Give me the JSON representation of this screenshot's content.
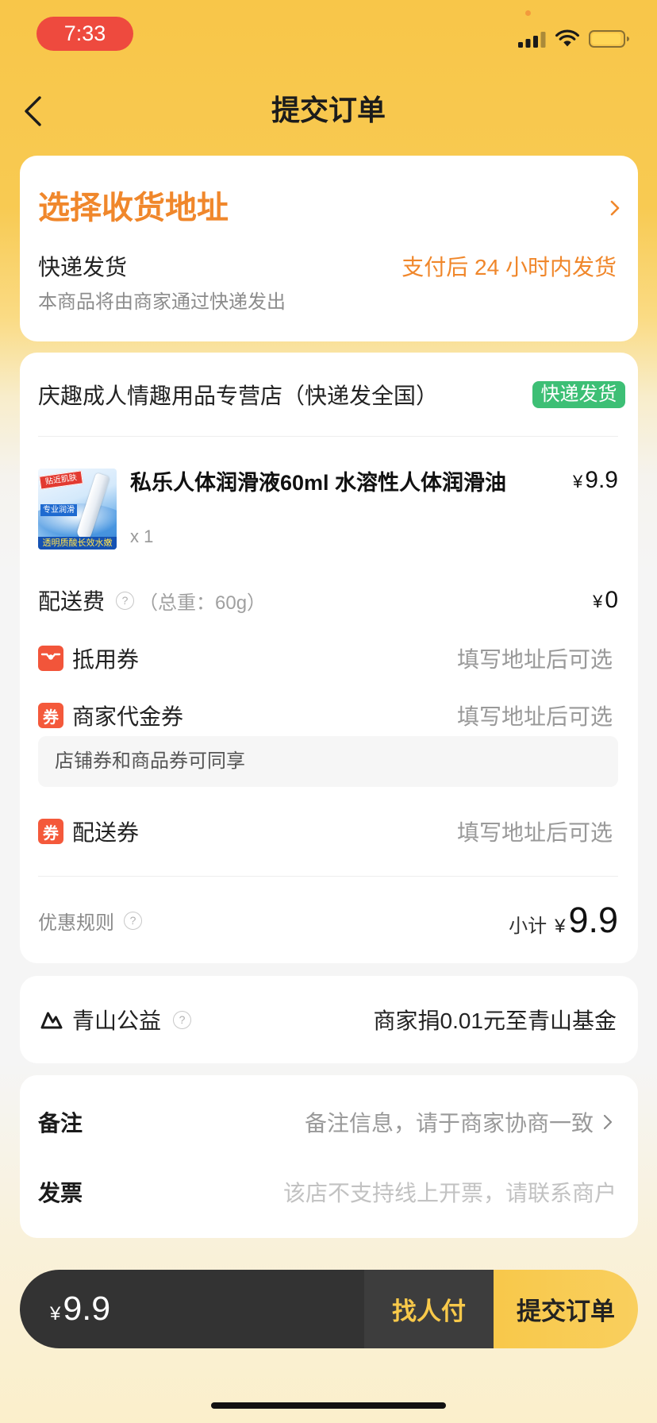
{
  "status_bar": {
    "time": "7:33",
    "icons": [
      "mic-in-use-dot",
      "cellular-signal-icon",
      "wifi-icon",
      "battery-icon"
    ]
  },
  "header": {
    "back_icon": "chevron-left-icon",
    "title": "提交订单"
  },
  "address_card": {
    "select_address": "选择收货地址",
    "select_address_icon": "chevron-right-icon",
    "delivery_method": "快递发货",
    "delivery_promise": "支付后 24 小时内发货",
    "delivery_note": "本商品将由商家通过快递发出"
  },
  "order_card": {
    "store_name": "庆趣成人情趣用品专营店（快递发全国）",
    "store_badge": "快递发货",
    "product": {
      "title": "私乐人体润滑液60ml 水溶性人体润滑油",
      "currency": "¥",
      "price": "9.9",
      "quantity": "x 1",
      "thumbnail_text": {
        "top_ribbon": "贴近肌肤",
        "middle_label": "专业润滑",
        "bottom_banner": "透明质酸长效水嫩"
      }
    },
    "shipping_fee": {
      "label": "配送费",
      "weight_note": "（总重：60g）",
      "currency": "¥",
      "value": "0"
    },
    "coupons": [
      {
        "label": "抵用券",
        "hint": "填写地址后可选",
        "icon": "coupon-envelope-icon"
      },
      {
        "label": "商家代金券",
        "hint": "填写地址后可选",
        "icon_text": "券",
        "note": "店铺券和商品券可同享"
      },
      {
        "label": "配送券",
        "hint": "填写地址后可选",
        "icon_text": "券"
      }
    ],
    "discount_rules": "优惠规则",
    "subtotal_label": "小计",
    "subtotal_currency": "¥",
    "subtotal_value": "9.9"
  },
  "help_glyph": "?",
  "charity": {
    "icon": "mountain-icon",
    "label": "青山公益",
    "description": "商家捐0.01元至青山基金"
  },
  "extras": {
    "remark_label": "备注",
    "remark_placeholder": "备注信息，请于商家协商一致",
    "invoice_label": "发票",
    "invoice_note": "该店不支持线上开票，请联系商户"
  },
  "bottom_bar": {
    "currency": "¥",
    "total": "9.9",
    "pay_for_me": "找人付",
    "submit": "提交订单"
  },
  "colors": {
    "brand_yellow": "#F8C94A",
    "accent_orange": "#F0872B",
    "badge_green": "#3DBF75",
    "coupon_red": "#F4593B",
    "bottom_bar_dark": "#333333",
    "time_pill_red": "#EE4A3E"
  }
}
